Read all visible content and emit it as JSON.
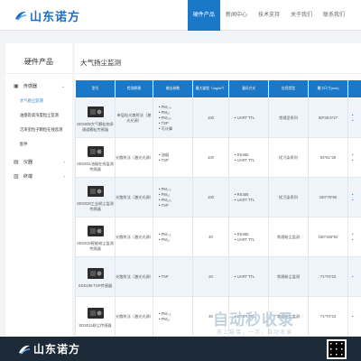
{
  "header": {
    "logo_text": "山东诺方",
    "nav": [
      "硬件产品",
      "新闻中心",
      "技术支持",
      "关于我们",
      "联系我们"
    ]
  },
  "sidebar": {
    "title": "硬件产品",
    "groups": [
      {
        "label": "传感器",
        "icon": "chip-icon",
        "sub": [
          "大气扬尘监测",
          "油烟及高浓度粒尘监测",
          "洁净室粒子颗粒在线监测",
          "配件"
        ]
      },
      {
        "label": "仪器",
        "icon": "instrument-icon"
      },
      {
        "label": "终端",
        "icon": "terminal-icon"
      }
    ]
  },
  "main": {
    "title": "大气扬尘监测",
    "headers": [
      "型号",
      "检测原理",
      "输出参数",
      "最大量程（mg/m³）",
      "通讯方式",
      "应用类型",
      "最小尺寸(mm)",
      ""
    ],
    "rows": [
      {
        "model": "SDS009大气颗粒物多通道颗粒传感器",
        "principle": "单层粒光散射法（激光光源）",
        "params": [
          "PM₂.₅",
          "PM₁₀",
          "PM₁₀₀",
          "TSP",
          "可计算"
        ],
        "range": "100",
        "comm": [
          "UART TTL"
        ],
        "app": "常规型系列",
        "size": "80*35.5*27",
        "extra": [
          "•",
          "•"
        ]
      },
      {
        "model": "SDS031油烟在线监测传感器",
        "principle": "光散射法（激光光源）",
        "params": [
          "油烟",
          "TSP"
        ],
        "range": "100",
        "comm": [
          "RS485",
          "UART TTL"
        ],
        "app": "扰污染系列",
        "size": "92*61*29",
        "extra": [
          "•",
          "•"
        ]
      },
      {
        "model": "SDS029工业粉尘监测传感器",
        "principle": "光散射法（激光光源）",
        "params": [
          "PM₂.₅",
          "PM₁₀",
          "PM₁₀₀",
          "TSP"
        ],
        "range": "100",
        "comm": [
          "RS485",
          "UART TTL"
        ],
        "app": "扰污染系列",
        "size": "150*78*65",
        "extra": [
          "•",
          "•"
        ]
      },
      {
        "model": "SDS019智能粉尘监测传感器",
        "principle": "光散射法（激光光源）",
        "params": [
          "PM₂.₅",
          "PM₁₀"
        ],
        "range": "30",
        "comm": [
          "RS485",
          "UART TTL"
        ],
        "app": "常规粉尘监测",
        "size": "180*165*82",
        "extra": [
          "•",
          "•"
        ]
      },
      {
        "model": "SDS198 TSP传感器",
        "principle": "光散射法（激光光源）",
        "params": [
          "TSP"
        ],
        "range": "20",
        "comm": [
          "UART TTL"
        ],
        "app": "常规粉尘监测",
        "size": "71*70*23",
        "extra": [
          "•"
        ]
      },
      {
        "model": "SDS011粉尘传感器",
        "principle": "光散射法（激光光源）",
        "params": [
          "PM₂.₅",
          "PM₁₀"
        ],
        "range": "30",
        "comm": [
          "UART TTL"
        ],
        "app": "常规粉尘监测",
        "size": "71*70*23",
        "extra": [
          "•"
        ]
      }
    ]
  },
  "footer": {
    "logo_text": "山东诺方"
  },
  "watermark": {
    "title": "自动秒收录",
    "sub": "放上链接，一次，自动收录"
  },
  "colors": {
    "brand": "#1b78c8",
    "footer": "#1d2a38"
  }
}
